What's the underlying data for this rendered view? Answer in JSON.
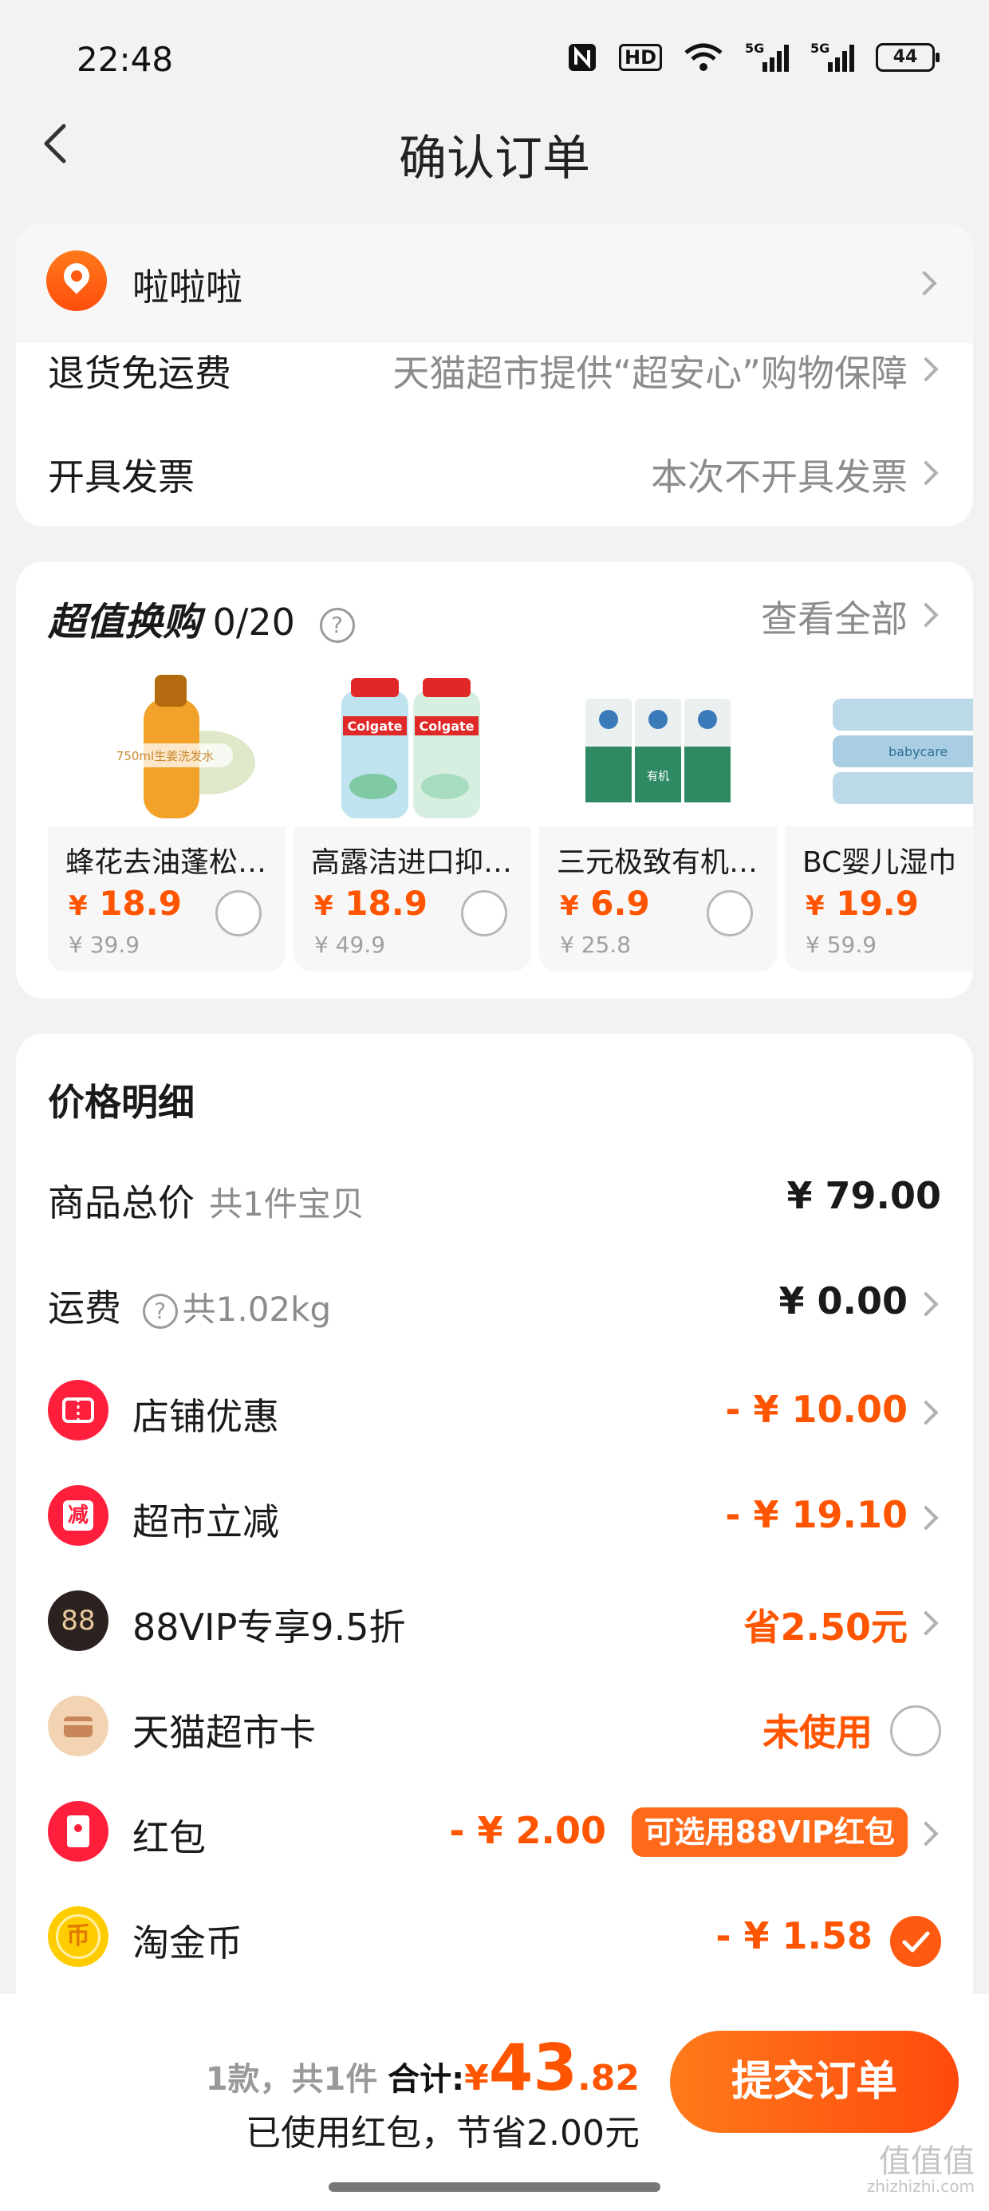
{
  "status_bar": {
    "time": "22:48",
    "icons": [
      "nfc-icon",
      "hd-icon",
      "wifi-icon",
      "5g-signal-icon",
      "5g-signal-icon"
    ],
    "hd": "HD",
    "battery": "44"
  },
  "nav": {
    "title": "确认订单",
    "back_icon": "chevron-left-icon"
  },
  "address": {
    "name": "啦啦啦",
    "icon": "location-pin-icon"
  },
  "options": [
    {
      "label": "退货免运费",
      "value": "天猫超市提供“超安心”购物保障"
    },
    {
      "label": "开具发票",
      "value": "本次不开具发票"
    }
  ],
  "swap": {
    "title": "超值换购",
    "count": "0/20",
    "help": "?",
    "view_all": "查看全部",
    "products": [
      {
        "name": "蜂花去油蓬松洗发水",
        "price": "18.9",
        "orig": "¥ 39.9",
        "img_text": "750ml生姜洗发水"
      },
      {
        "name": "高露洁进口抑菌漱口水",
        "price": "18.9",
        "orig": "¥ 49.9",
        "img_text": "Colgate"
      },
      {
        "name": "三元极致有机纯牛奶",
        "price": "6.9",
        "orig": "¥ 25.8",
        "img_text": "有机"
      },
      {
        "name": "BC婴儿湿巾",
        "price": "19.9",
        "orig": "¥ 59.9",
        "img_text": "babycare"
      }
    ]
  },
  "price_detail": {
    "title": "价格明细",
    "currency": "¥",
    "rows": [
      {
        "label": "商品总价",
        "sub": "共1件宝贝",
        "amount": "¥ 79.00"
      },
      {
        "label": "运费",
        "sub": "共1.02kg",
        "amount": "¥ 0.00"
      },
      {
        "label": "店铺优惠",
        "amount": "- ¥ 10.00",
        "icon": "shop-coupon-icon",
        "color": "#ff1f3d"
      },
      {
        "label": "超市立减",
        "amount": "- ¥ 19.10",
        "icon": "discount-icon",
        "icon_text": "减",
        "color": "#ff1f3d"
      },
      {
        "label": "88VIP专享9.5折",
        "amount": "省2.50元",
        "icon": "88vip-icon",
        "icon_text": "88",
        "color": "#2b2220"
      },
      {
        "label": "天猫超市卡",
        "amount": "未使用",
        "icon": "card-icon",
        "color": "#f2d4b3"
      },
      {
        "label": "红包",
        "amount": "- ¥ 2.00",
        "badge": "可选用88VIP红包",
        "icon": "red-envelope-icon",
        "color": "#ff1f3d"
      },
      {
        "label": "淘金币",
        "amount": "- ¥ 1.58",
        "icon": "gold-coin-icon",
        "icon_text": "币",
        "color": "#ffcc00"
      }
    ]
  },
  "bottom": {
    "count_text": "1款，共1件",
    "total_label": "合计:",
    "total_currency": "¥",
    "total_int": "43",
    "total_dec": ".82",
    "saved_text": "已使用红包，节省2.00元",
    "submit": "提交订单",
    "watermark": "值值值",
    "watermark_url": "zhizhizhi.com"
  },
  "colors": {
    "accent": "#ff5500",
    "red": "#ff1f3d",
    "bg": "#f2f2f2"
  }
}
